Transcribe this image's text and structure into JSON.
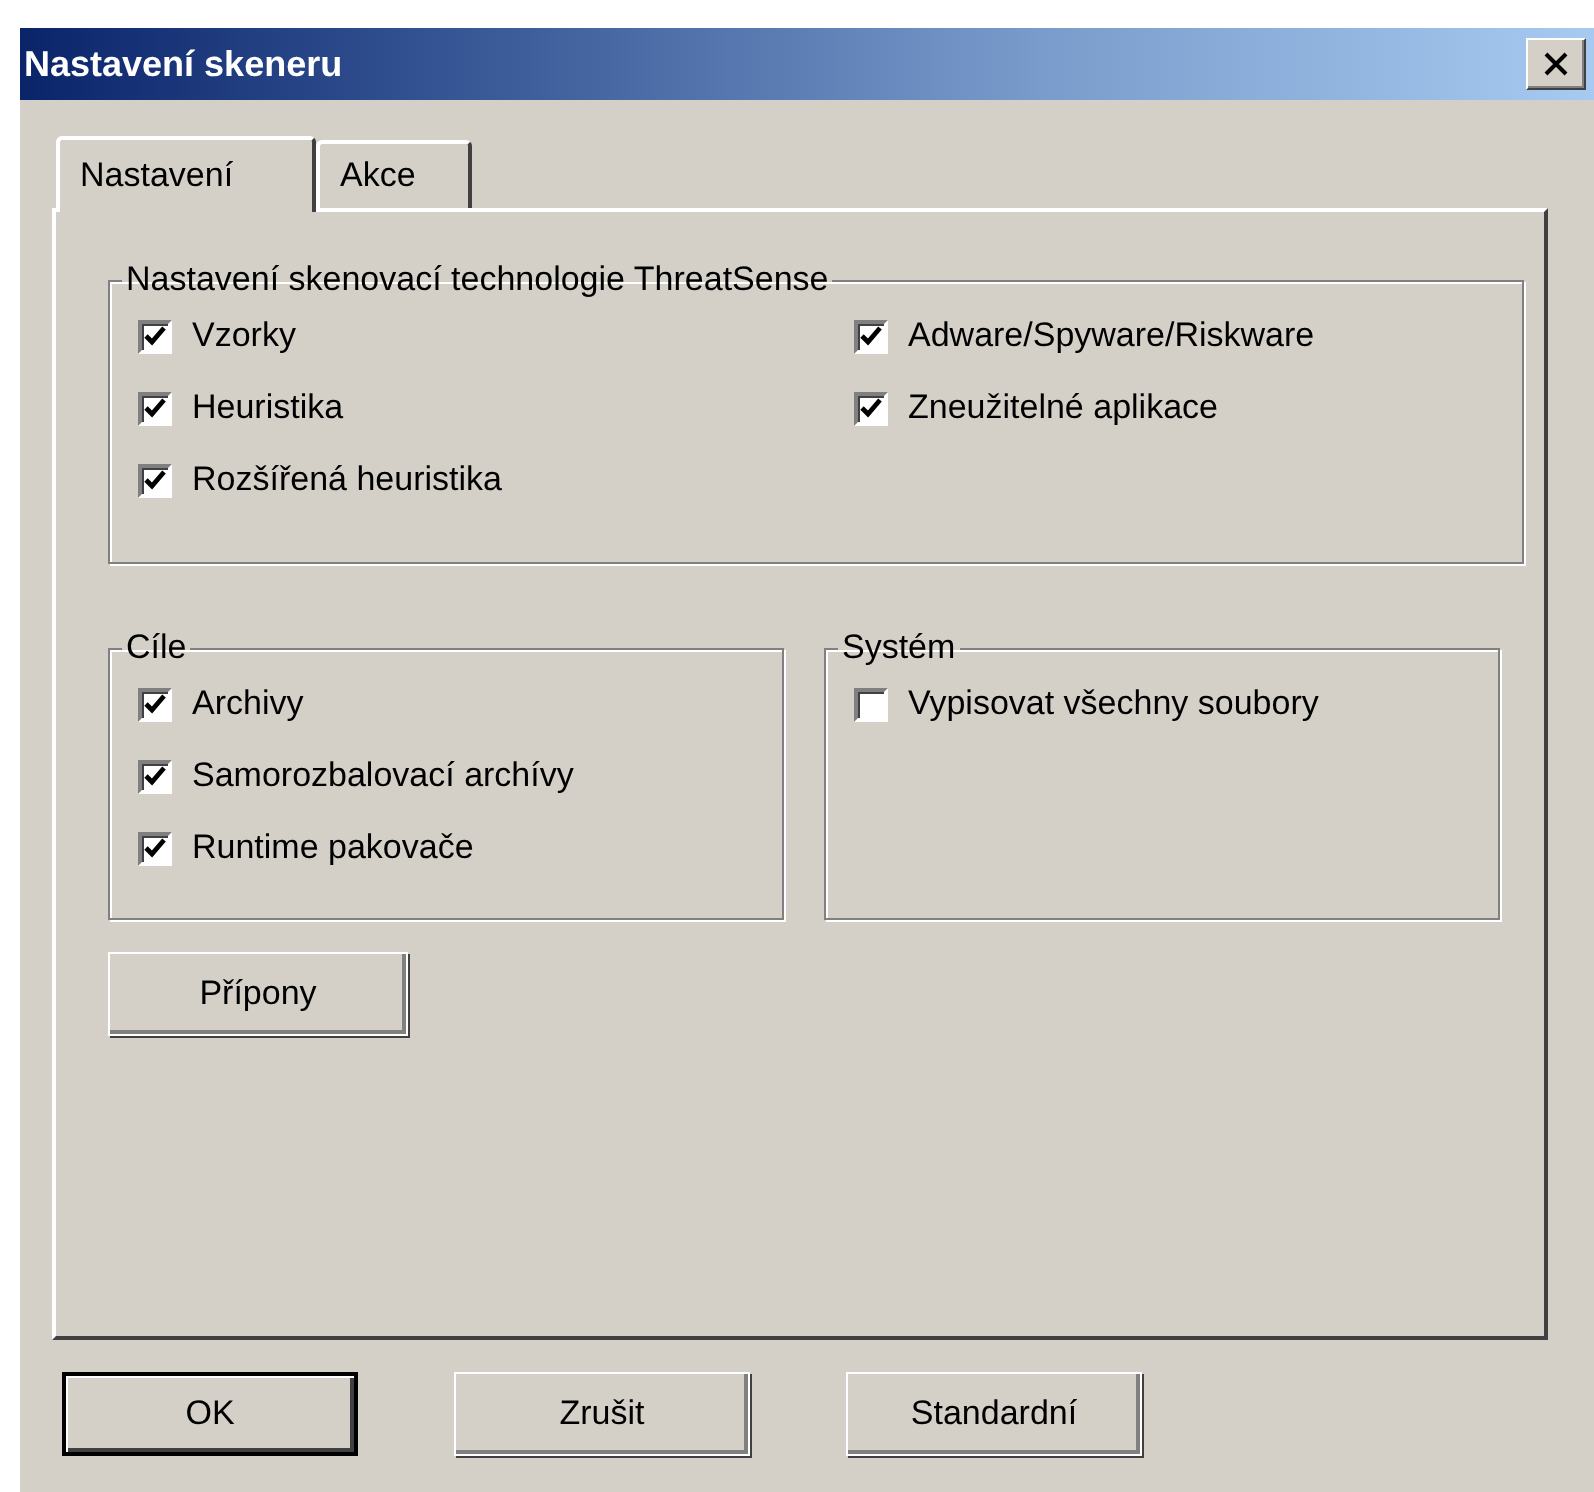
{
  "window": {
    "title": "Nastavení skeneru"
  },
  "tabs": [
    {
      "label": "Nastavení",
      "selected": true
    },
    {
      "label": "Akce",
      "selected": false
    }
  ],
  "threatsense": {
    "title": "Nastavení skenovací technologie ThreatSense",
    "columns": [
      [
        {
          "label": "Vzorky",
          "checked": true
        },
        {
          "label": "Heuristika",
          "checked": true
        },
        {
          "label": "Rozšířená heuristika",
          "checked": true
        }
      ],
      [
        {
          "label": "Adware/Spyware/Riskware",
          "checked": true
        },
        {
          "label": "Zneužitelné aplikace",
          "checked": true
        }
      ]
    ]
  },
  "targets": {
    "title": "Cíle",
    "items": [
      {
        "label": "Archivy",
        "checked": true
      },
      {
        "label": "Samorozbalovací archívy",
        "checked": true
      },
      {
        "label": "Runtime pakovače",
        "checked": true
      }
    ]
  },
  "system": {
    "title": "Systém",
    "items": [
      {
        "label": "Vypisovat všechny soubory",
        "checked": false
      }
    ]
  },
  "extensions_button": "Přípony",
  "buttons": [
    {
      "label": "OK",
      "default": true
    },
    {
      "label": "Zrušit",
      "default": false
    },
    {
      "label": "Standardní",
      "default": false
    }
  ]
}
